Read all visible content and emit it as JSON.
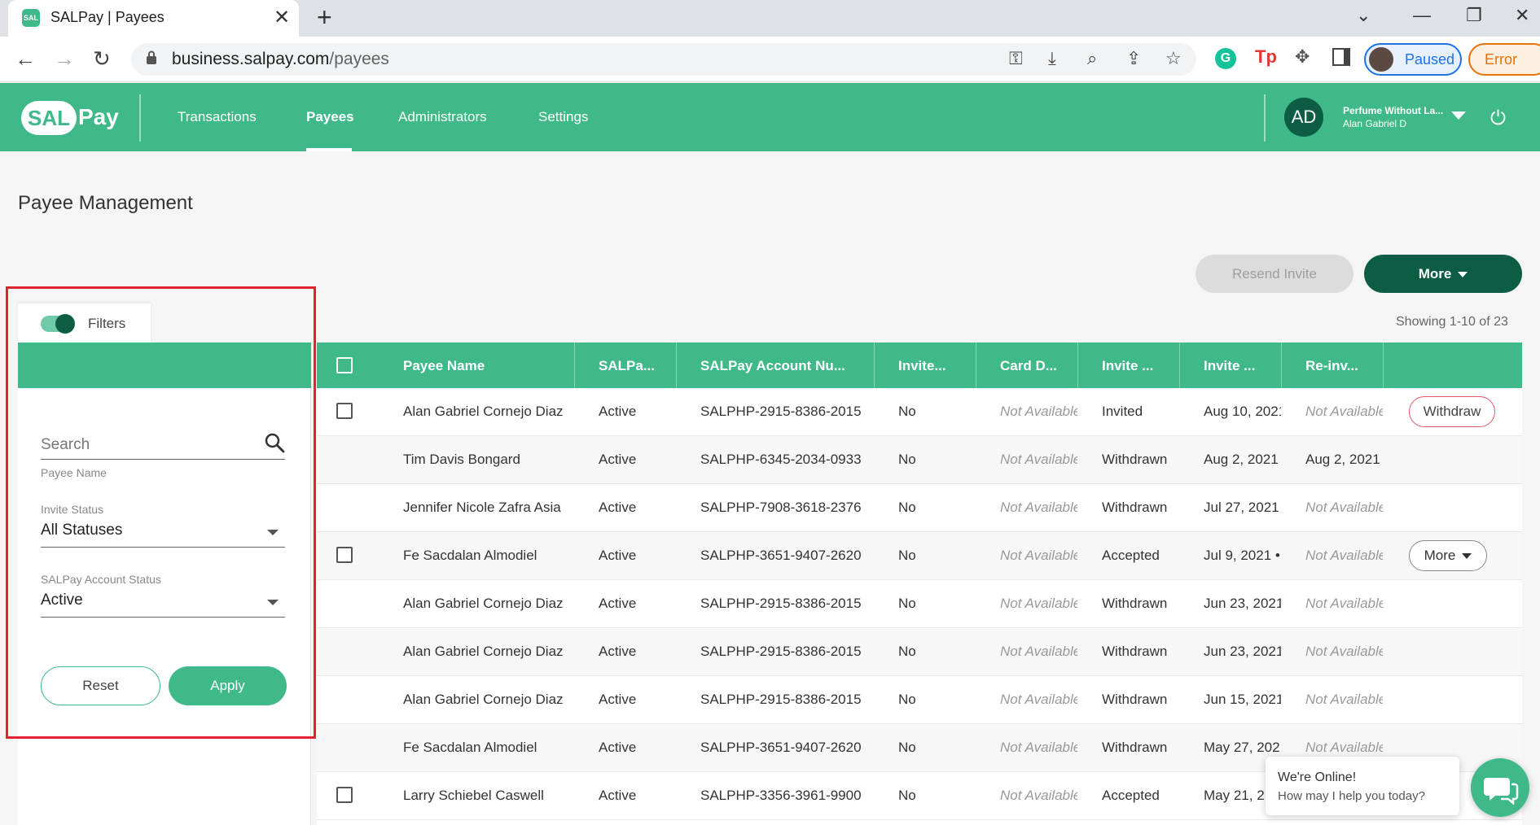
{
  "browser": {
    "tab_title": "SALPay | Payees",
    "favicon_text": "SAL",
    "url_host": "business.salpay.com",
    "url_path": "/payees",
    "profile_label": "Paused",
    "error_label": "Error"
  },
  "nav": {
    "logo_sal": "SAL",
    "logo_pay": "Pay",
    "links": [
      "Transactions",
      "Payees",
      "Administrators",
      "Settings"
    ],
    "active": "Payees",
    "avatar_initials": "AD",
    "account_org": "Perfume Without La...",
    "account_user": "Alan Gabriel D"
  },
  "page": {
    "title": "Payee Management",
    "resend_label": "Resend Invite",
    "more_label": "More",
    "showing": "Showing 1-10 of 23"
  },
  "filters": {
    "tab_label": "Filters",
    "search_placeholder": "Search",
    "search_helper": "Payee Name",
    "invite_status_label": "Invite Status",
    "invite_status_value": "All Statuses",
    "account_status_label": "SALPay Account Status",
    "account_status_value": "Active",
    "reset_label": "Reset",
    "apply_label": "Apply"
  },
  "table": {
    "headers": [
      "Payee Name",
      "SALPa...",
      "SALPay Account Nu...",
      "Invite...",
      "Card D...",
      "Invite ...",
      "Invite ...",
      "Re-inv..."
    ],
    "rows": [
      {
        "name": "Alan Gabriel Cornejo Diaz",
        "status": "Active",
        "account": "SALPHP-2915-8386-2015",
        "invite": "No",
        "card": "Not Available",
        "invite_status": "Invited",
        "invite_date": "Aug 10, 2021",
        "reinvite": "Not Available",
        "checkbox": true,
        "action": "Withdraw"
      },
      {
        "name": "Tim Davis Bongard",
        "status": "Active",
        "account": "SALPHP-6345-2034-0933",
        "invite": "No",
        "card": "Not Available",
        "invite_status": "Withdrawn",
        "invite_date": "Aug 2, 2021",
        "reinvite": "Aug 2, 2021",
        "checkbox": false,
        "action": ""
      },
      {
        "name": "Jennifer Nicole Zafra Asia",
        "status": "Active",
        "account": "SALPHP-7908-3618-2376",
        "invite": "No",
        "card": "Not Available",
        "invite_status": "Withdrawn",
        "invite_date": "Jul 27, 2021",
        "reinvite": "Not Available",
        "checkbox": false,
        "action": ""
      },
      {
        "name": "Fe Sacdalan Almodiel",
        "status": "Active",
        "account": "SALPHP-3651-9407-2620",
        "invite": "No",
        "card": "Not Available",
        "invite_status": "Accepted",
        "invite_date": "Jul 9, 2021 •",
        "reinvite": "Not Available",
        "checkbox": true,
        "action": "More"
      },
      {
        "name": "Alan Gabriel Cornejo Diaz",
        "status": "Active",
        "account": "SALPHP-2915-8386-2015",
        "invite": "No",
        "card": "Not Available",
        "invite_status": "Withdrawn",
        "invite_date": "Jun 23, 2021",
        "reinvite": "Not Available",
        "checkbox": false,
        "action": ""
      },
      {
        "name": "Alan Gabriel Cornejo Diaz",
        "status": "Active",
        "account": "SALPHP-2915-8386-2015",
        "invite": "No",
        "card": "Not Available",
        "invite_status": "Withdrawn",
        "invite_date": "Jun 23, 2021",
        "reinvite": "Not Available",
        "checkbox": false,
        "action": ""
      },
      {
        "name": "Alan Gabriel Cornejo Diaz",
        "status": "Active",
        "account": "SALPHP-2915-8386-2015",
        "invite": "No",
        "card": "Not Available",
        "invite_status": "Withdrawn",
        "invite_date": "Jun 15, 2021",
        "reinvite": "Not Available",
        "checkbox": false,
        "action": ""
      },
      {
        "name": "Fe Sacdalan Almodiel",
        "status": "Active",
        "account": "SALPHP-3651-9407-2620",
        "invite": "No",
        "card": "Not Available",
        "invite_status": "Withdrawn",
        "invite_date": "May 27, 202",
        "reinvite": "Not Available",
        "checkbox": false,
        "action": ""
      },
      {
        "name": "Larry Schiebel Caswell",
        "status": "Active",
        "account": "SALPHP-3356-3961-9900",
        "invite": "No",
        "card": "Not Available",
        "invite_status": "Accepted",
        "invite_date": "May 21, 2",
        "reinvite": "",
        "checkbox": true,
        "action": ""
      }
    ]
  },
  "chat": {
    "line1": "We're Online!",
    "line2": "How may I help you today?"
  }
}
